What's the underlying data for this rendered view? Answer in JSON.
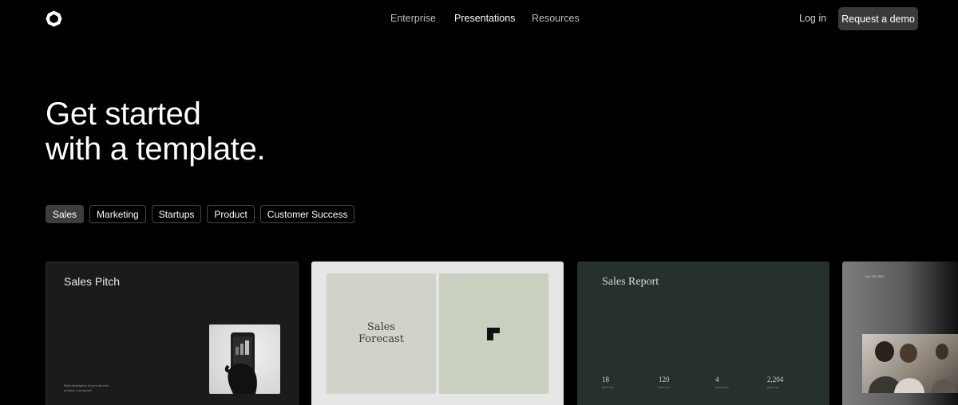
{
  "nav": {
    "links": [
      {
        "label": "Enterprise"
      },
      {
        "label": "Presentations"
      },
      {
        "label": "Resources"
      }
    ],
    "login_label": "Log in",
    "demo_label": "Request a demo"
  },
  "hero": {
    "line1": "Get started",
    "line2": "with a template."
  },
  "filters": [
    {
      "label": "Sales",
      "active": true
    },
    {
      "label": "Marketing"
    },
    {
      "label": "Startups"
    },
    {
      "label": "Product"
    },
    {
      "label": "Customer Success"
    }
  ],
  "templates": [
    {
      "title": "Sales Pitch",
      "caption": "Brief description of your service, product or proposal"
    },
    {
      "title_line1": "Sales",
      "title_line2": "Forecast"
    },
    {
      "title": "Sales Report",
      "metrics": [
        {
          "value": "18",
          "label": "Metric One"
        },
        {
          "value": "120",
          "label": "Metric Two"
        },
        {
          "value": "4",
          "label": "Metric Three"
        },
        {
          "value": "2,204",
          "label": "Metric Four"
        }
      ]
    },
    {
      "small_text": "Nov '20 2020"
    }
  ],
  "colors": {
    "background": "#000000",
    "chip_active": "#3d3d3d",
    "demo_button": "#3a3a3a"
  }
}
